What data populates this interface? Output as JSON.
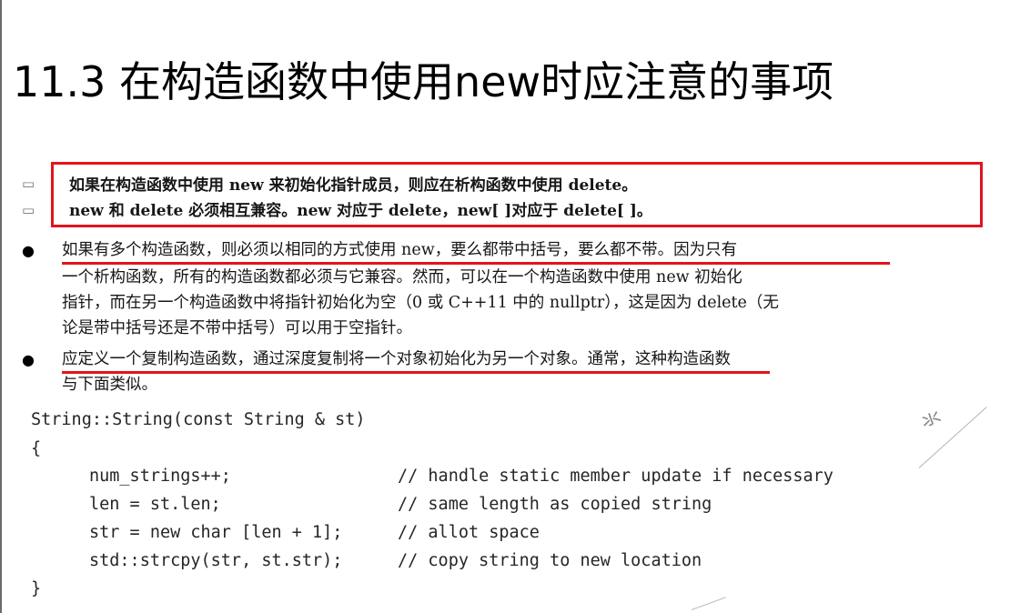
{
  "slide": {
    "title": "11.3 在构造函数中使用new时应注意的事项",
    "boxed_points": [
      {
        "bullet": "▭",
        "text": "如果在构造函数中使用 new 来初始化指针成员，则应在析构函数中使用 delete。"
      },
      {
        "bullet": "▭",
        "text": "new 和 delete 必须相互兼容。new 对应于 delete，new[ ]对应于 delete[ ]。"
      }
    ],
    "points": [
      {
        "bullet": "●",
        "lines": [
          "如果有多个构造函数，则必须以相同的方式使用 new，要么都带中括号，要么都不带。因为只有",
          "一个析构函数，所有的构造函数都必须与它兼容。然而，可以在一个构造函数中使用 new 初始化",
          "指针，而在另一个构造函数中将指针初始化为空（0 或 C++11 中的 nullptr），这是因为 delete（无",
          "论是带中括号还是不带中括号）可以用于空指针。"
        ]
      },
      {
        "bullet": "●",
        "lines": [
          "应定义一个复制构造函数，通过深度复制将一个对象初始化为另一个对象。通常，这种构造函数",
          "与下面类似。"
        ]
      }
    ],
    "code": {
      "signature": "String::String(const String & st)",
      "open_brace": "{",
      "statements": [
        {
          "stmt": "num_strings++;",
          "comment": "// handle static member update if necessary"
        },
        {
          "stmt": "len = st.len;",
          "comment": "// same length as copied string"
        },
        {
          "stmt": "str = new char [len + 1];",
          "comment": "// allot space"
        },
        {
          "stmt": "std::strcpy(str, st.str);",
          "comment": "// copy string to new location"
        }
      ],
      "close_brace": "}"
    },
    "colors": {
      "highlight_red": "#e0141e",
      "text": "#161616"
    }
  }
}
